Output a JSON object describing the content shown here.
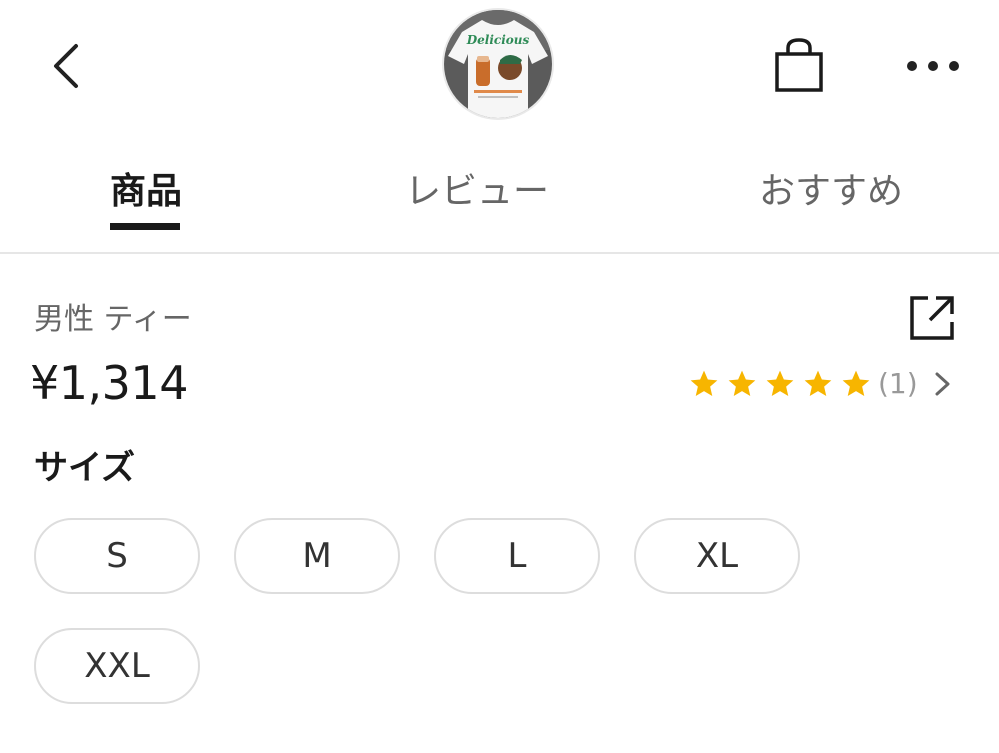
{
  "header": {
    "back_icon": "chevron-left-icon",
    "product_thumbnail": "product-thumbnail",
    "thumbnail_text": "Delicious",
    "bag_icon": "shopping-bag-icon",
    "more_icon": "more-horizontal-icon"
  },
  "tabs": [
    {
      "label": "商品",
      "active": true
    },
    {
      "label": "レビュー",
      "active": false
    },
    {
      "label": "おすすめ",
      "active": false
    }
  ],
  "product": {
    "title": "男性 ティー",
    "price": "¥1,314",
    "share_icon": "share-external-icon",
    "rating": {
      "stars": 5,
      "count_text": "(1)"
    }
  },
  "sizes": {
    "label": "サイズ",
    "options": [
      "S",
      "M",
      "L",
      "XL",
      "XXL"
    ]
  },
  "colors": {
    "star": "#F7B500",
    "active_text": "#1a1a1a",
    "inactive_text": "#666666",
    "chip_border": "#dddddd"
  }
}
